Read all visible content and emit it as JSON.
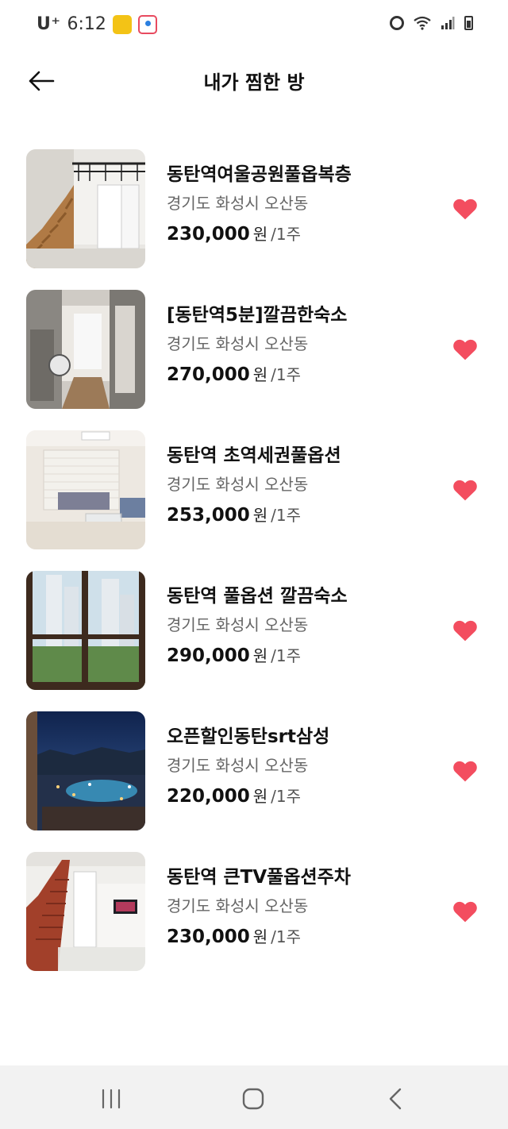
{
  "status_bar": {
    "carrier": "U⁺",
    "time": "6:12",
    "icons": [
      "yellow-app-notification-icon",
      "map-app-notification-icon",
      "alarm-icon",
      "wifi-icon",
      "signal-icon",
      "battery-icon"
    ]
  },
  "header": {
    "title": "내가 찜한 방",
    "back_icon": "arrow-left-icon"
  },
  "listings": [
    {
      "name": "동탄역여울공원풀옵복층",
      "location": "경기도 화성시 오산동",
      "price": "230,000",
      "currency": "원",
      "period": "/1주",
      "liked": true
    },
    {
      "name": "[동탄역5분]깔끔한숙소",
      "location": "경기도 화성시 오산동",
      "price": "270,000",
      "currency": "원",
      "period": "/1주",
      "liked": true
    },
    {
      "name": "동탄역 초역세권풀옵션",
      "location": "경기도 화성시 오산동",
      "price": "253,000",
      "currency": "원",
      "period": "/1주",
      "liked": true
    },
    {
      "name": "동탄역 풀옵션 깔끔숙소",
      "location": "경기도 화성시 오산동",
      "price": "290,000",
      "currency": "원",
      "period": "/1주",
      "liked": true
    },
    {
      "name": "오픈할인동탄srt삼성",
      "location": "경기도 화성시 오산동",
      "price": "220,000",
      "currency": "원",
      "period": "/1주",
      "liked": true
    },
    {
      "name": "동탄역 큰TV풀옵션주차",
      "location": "경기도 화성시 오산동",
      "price": "230,000",
      "currency": "원",
      "period": "/1주",
      "liked": true
    }
  ],
  "colors": {
    "heart": "#f34d5f",
    "accent_text": "#111111",
    "secondary_text": "#666666",
    "nav_background": "#f2f2f2"
  },
  "nav_bar": {
    "icons": [
      "recent-apps-icon",
      "home-icon",
      "back-chevron-icon"
    ]
  }
}
